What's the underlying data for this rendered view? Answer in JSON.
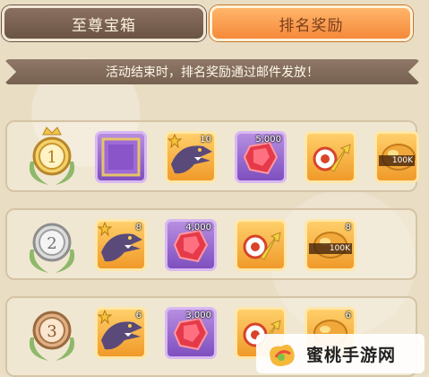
{
  "tabs": [
    {
      "label": "至尊宝箱",
      "active": false
    },
    {
      "label": "排名奖励",
      "active": true
    }
  ],
  "notice": "活动结束时，排名奖励通过邮件发放！",
  "ranks": [
    {
      "rank": 1,
      "items": [
        {
          "name": "purple-frame",
          "quantity": ""
        },
        {
          "name": "raptor-dino",
          "quantity": "10"
        },
        {
          "name": "red-gem",
          "quantity": "5,000"
        },
        {
          "name": "target-arrow-boost",
          "quantity": ""
        },
        {
          "name": "gold-ore",
          "quantity": "",
          "tag": "100K"
        }
      ]
    },
    {
      "rank": 2,
      "items": [
        {
          "name": "raptor-dino",
          "quantity": "8"
        },
        {
          "name": "red-gem",
          "quantity": "4,000"
        },
        {
          "name": "target-arrow-boost",
          "quantity": ""
        },
        {
          "name": "gold-ore",
          "quantity": "8",
          "tag": "100K"
        }
      ]
    },
    {
      "rank": 3,
      "items": [
        {
          "name": "raptor-dino",
          "quantity": "6"
        },
        {
          "name": "red-gem",
          "quantity": "3,000"
        },
        {
          "name": "target-arrow-boost",
          "quantity": ""
        },
        {
          "name": "gold-ore",
          "quantity": "6"
        }
      ]
    }
  ],
  "watermark": "蜜桃手游网",
  "colors": {
    "gold": "#e8b53a",
    "silver": "#c9c9c9",
    "bronze": "#d09a6a",
    "accent": "#f5893a"
  }
}
